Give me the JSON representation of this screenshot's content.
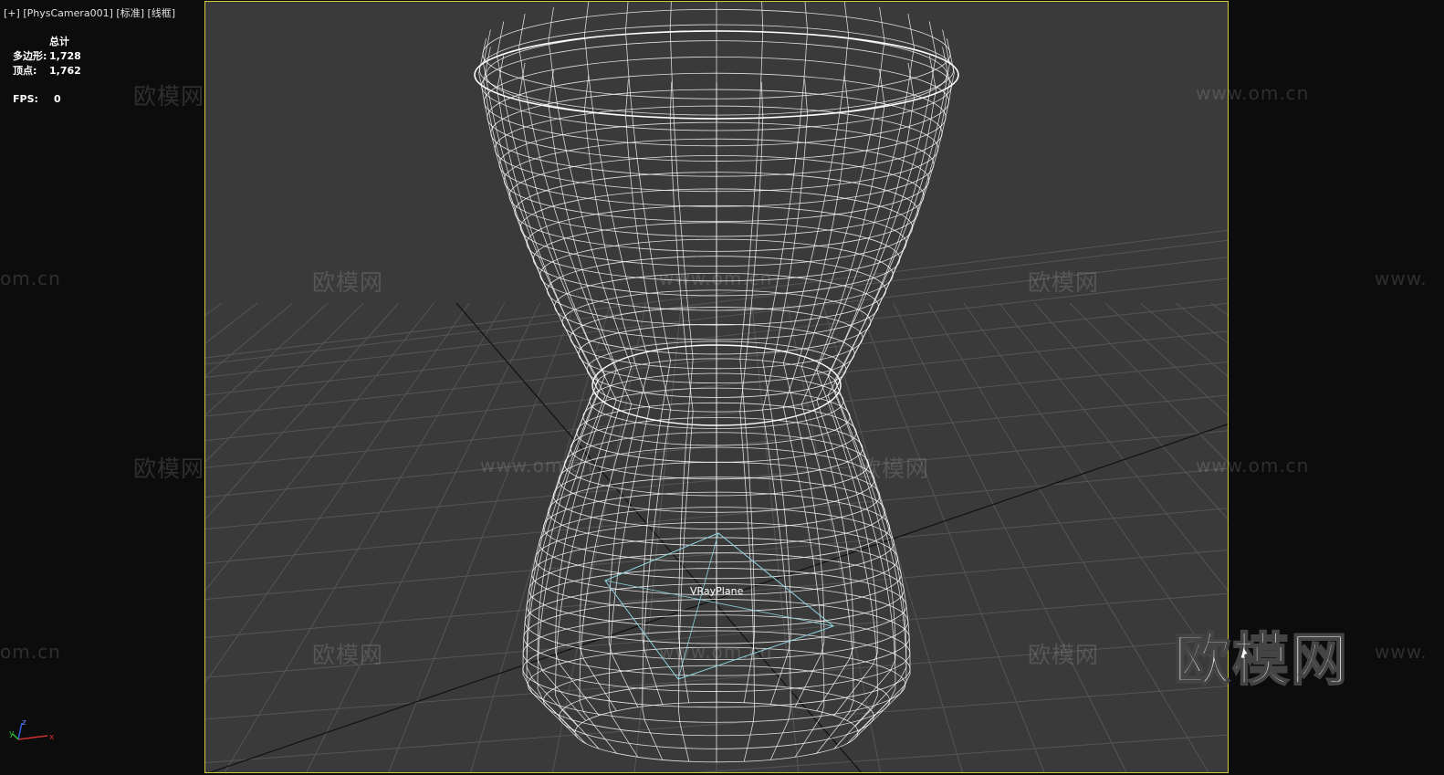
{
  "viewport_header": {
    "plus": "[+]",
    "camera": "[PhysCamera001]",
    "mode": "[标准]",
    "shading": "[线框]"
  },
  "stats": {
    "total_label": "总计",
    "polygons_label": "多边形:",
    "polygons_value": "1,728",
    "vertices_label": "顶点:",
    "vertices_value": "1,762",
    "fps_label": "FPS:",
    "fps_value": "0"
  },
  "scene": {
    "object_label": "VRayPlane",
    "wire_color": "#ffffff",
    "plane_color": "#8fd3e0",
    "grid_color": "#555555",
    "border_color": "#d6c63a"
  },
  "axis": {
    "x": "x",
    "y": "y",
    "z": "z"
  },
  "watermarks": {
    "cn": "欧模网",
    "url": "www.om.cn",
    "url_short": "om.cn",
    "url_prefix": "www.",
    "logo": "欧模网"
  }
}
